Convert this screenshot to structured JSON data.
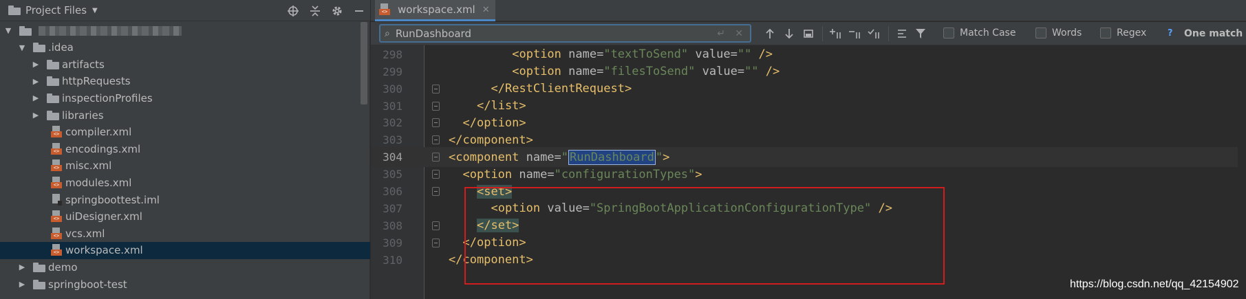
{
  "project_panel": {
    "title": "Project Files",
    "header_icons": [
      "crosshair-icon",
      "collapse-icon",
      "gear-icon",
      "minimize-icon"
    ]
  },
  "tree": [
    {
      "label": "",
      "type": "root-blurred",
      "expanded": true,
      "depth": 0
    },
    {
      "label": ".idea",
      "type": "folder",
      "expanded": true,
      "depth": 1
    },
    {
      "label": "artifacts",
      "type": "folder",
      "expanded": false,
      "depth": 2
    },
    {
      "label": "httpRequests",
      "type": "folder",
      "expanded": false,
      "depth": 2
    },
    {
      "label": "inspectionProfiles",
      "type": "folder",
      "expanded": false,
      "depth": 2
    },
    {
      "label": "libraries",
      "type": "folder",
      "expanded": false,
      "depth": 2
    },
    {
      "label": "compiler.xml",
      "type": "xml",
      "depth": 2
    },
    {
      "label": "encodings.xml",
      "type": "xml",
      "depth": 2
    },
    {
      "label": "misc.xml",
      "type": "xml",
      "depth": 2
    },
    {
      "label": "modules.xml",
      "type": "xml",
      "depth": 2
    },
    {
      "label": "springboottest.iml",
      "type": "iml",
      "depth": 2
    },
    {
      "label": "uiDesigner.xml",
      "type": "xml",
      "depth": 2
    },
    {
      "label": "vcs.xml",
      "type": "xml",
      "depth": 2
    },
    {
      "label": "workspace.xml",
      "type": "xml",
      "depth": 2,
      "selected": true
    },
    {
      "label": "demo",
      "type": "folder",
      "expanded": false,
      "depth": 1
    },
    {
      "label": "springboot-test",
      "type": "folder",
      "expanded": false,
      "depth": 1
    }
  ],
  "editor_tab": {
    "label": "workspace.xml"
  },
  "find": {
    "query": "RunDashboard",
    "match_case": "Match Case",
    "words": "Words",
    "regex": "Regex",
    "help": "?",
    "result": "One match"
  },
  "code_lines": [
    {
      "num": "298",
      "current": false
    },
    {
      "num": "299",
      "current": false
    },
    {
      "num": "300",
      "current": false
    },
    {
      "num": "301",
      "current": false
    },
    {
      "num": "302",
      "current": false
    },
    {
      "num": "303",
      "current": false
    },
    {
      "num": "304",
      "current": true
    },
    {
      "num": "305",
      "current": false
    },
    {
      "num": "306",
      "current": false
    },
    {
      "num": "307",
      "current": false
    },
    {
      "num": "308",
      "current": false
    },
    {
      "num": "309",
      "current": false
    },
    {
      "num": "310",
      "current": false
    }
  ],
  "code": {
    "l298": {
      "open": "<option",
      "a1": " name=",
      "v1": "\"textToSend\"",
      "a2": " value=",
      "v2": "\"\"",
      "close": " />"
    },
    "l299": {
      "open": "<option",
      "a1": " name=",
      "v1": "\"filesToSend\"",
      "a2": " value=",
      "v2": "\"\"",
      "close": " />"
    },
    "l300": {
      "tag": "</RestClientRequest>"
    },
    "l301": {
      "tag": "</list>"
    },
    "l302": {
      "tag": "</option>"
    },
    "l303": {
      "tag": "</component>"
    },
    "l304": {
      "open": "<component",
      "a1": " name=",
      "q1": "\"",
      "match": "RunDashboard",
      "q2": "\"",
      "close": ">"
    },
    "l305": {
      "open": "<option",
      "a1": " name=",
      "v1": "\"configurationTypes\"",
      "close": ">"
    },
    "l306": {
      "tag": "<set>"
    },
    "l307": {
      "open": "<option",
      "a1": " value=",
      "v1": "\"SpringBootApplicationConfigurationType\"",
      "close": " />"
    },
    "l308": {
      "tag": "</set>"
    },
    "l309": {
      "tag": "</option>"
    },
    "l310": {
      "tag": "</component>"
    }
  },
  "watermark": "https://blog.csdn.net/qq_42154902",
  "colors": {
    "tag": "#e8bf6a",
    "attr_value": "#6a8759",
    "selection": "#0d293e",
    "annotation_box": "#d11d1d"
  }
}
